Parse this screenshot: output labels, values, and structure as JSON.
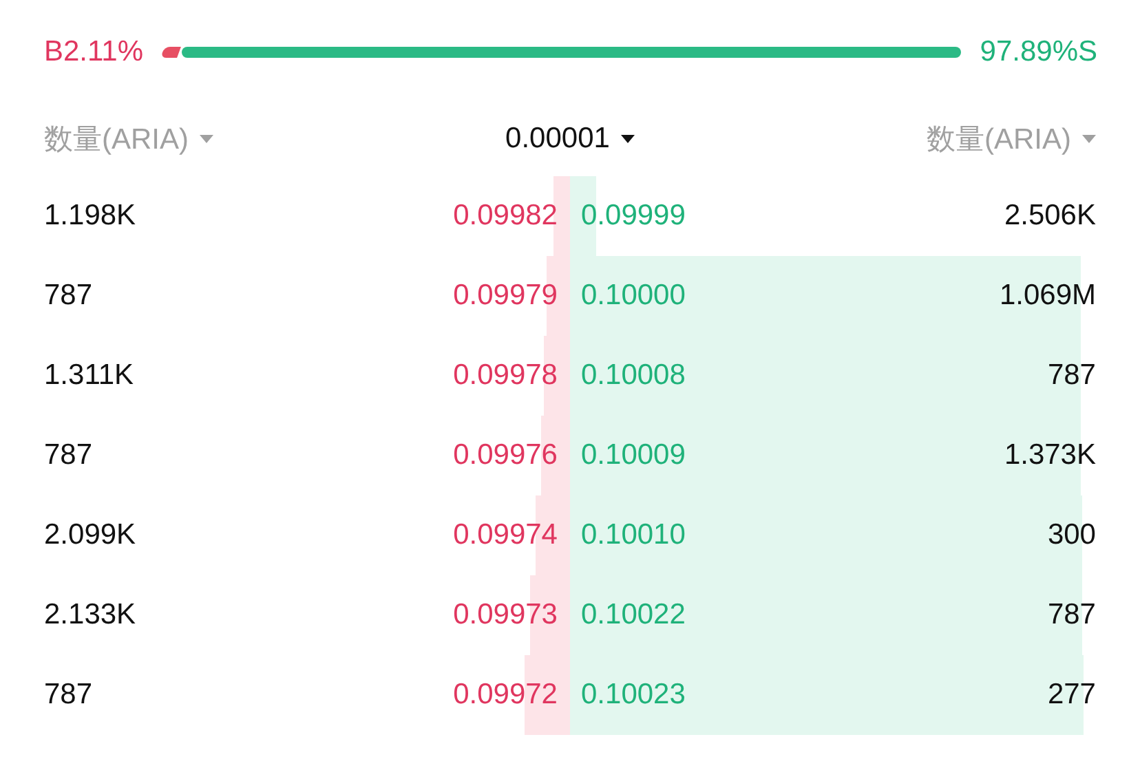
{
  "ratio": {
    "buy_label": "B2.11%",
    "sell_label": "97.89%S",
    "level": 0.0211
  },
  "header": {
    "left": "数量(ARIA)",
    "precision": "0.00001",
    "right": "数量(ARIA)"
  },
  "rows": [
    {
      "bid": {
        "qty": "1.198K",
        "price": "0.09982",
        "level": 0.03
      },
      "ask": {
        "price": "0.09999",
        "qty": "2.506K",
        "level": 0.045
      }
    },
    {
      "bid": {
        "qty": "787",
        "price": "0.09979",
        "level": 0.04
      },
      "ask": {
        "price": "0.10000",
        "qty": "1.069M",
        "level": 0.895
      }
    },
    {
      "bid": {
        "qty": "1.311K",
        "price": "0.09978",
        "level": 0.045
      },
      "ask": {
        "price": "0.10008",
        "qty": "787",
        "level": 0.896
      }
    },
    {
      "bid": {
        "qty": "787",
        "price": "0.09976",
        "level": 0.05
      },
      "ask": {
        "price": "0.10009",
        "qty": "1.373K",
        "level": 0.897
      }
    },
    {
      "bid": {
        "qty": "2.099K",
        "price": "0.09974",
        "level": 0.06
      },
      "ask": {
        "price": "0.10010",
        "qty": "300",
        "level": 0.898
      }
    },
    {
      "bid": {
        "qty": "2.133K",
        "price": "0.09973",
        "level": 0.07
      },
      "ask": {
        "price": "0.10022",
        "qty": "787",
        "level": 0.899
      }
    },
    {
      "bid": {
        "qty": "787",
        "price": "0.09972",
        "level": 0.08
      },
      "ask": {
        "price": "0.10023",
        "qty": "277",
        "level": 0.9
      }
    }
  ]
}
